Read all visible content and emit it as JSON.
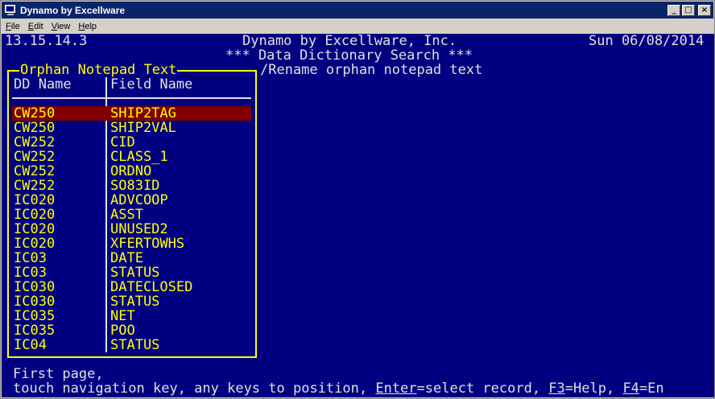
{
  "window": {
    "title": "Dynamo by Excellware",
    "minimize": "_",
    "maximize": "□",
    "close": "×"
  },
  "menu": [
    "File",
    "Edit",
    "View",
    "Help"
  ],
  "console": {
    "version": "13.15.14.3",
    "company": "Dynamo by Excellware, Inc.",
    "date": "Sun 06/08/2014",
    "subtitle": "*** Data Dictionary Search ***",
    "panel_title": "Orphan Notepad Text",
    "message": "/Rename orphan notepad text",
    "columns": [
      "DD Name",
      "Field Name"
    ],
    "rows": [
      {
        "dd": "CW250",
        "field": "SHIP2TAG",
        "selected": true
      },
      {
        "dd": "CW250",
        "field": "SHIP2VAL"
      },
      {
        "dd": "CW252",
        "field": "CID"
      },
      {
        "dd": "CW252",
        "field": "CLASS_1"
      },
      {
        "dd": "CW252",
        "field": "ORDNO"
      },
      {
        "dd": "CW252",
        "field": "SO83ID"
      },
      {
        "dd": "IC020",
        "field": "ADVCOOP"
      },
      {
        "dd": "IC020",
        "field": "ASST"
      },
      {
        "dd": "IC020",
        "field": "UNUSED2"
      },
      {
        "dd": "IC020",
        "field": "XFERTOWHS"
      },
      {
        "dd": "IC03",
        "field": "DATE"
      },
      {
        "dd": "IC03",
        "field": "STATUS"
      },
      {
        "dd": "IC030",
        "field": "DATECLOSED"
      },
      {
        "dd": "IC030",
        "field": "STATUS"
      },
      {
        "dd": "IC035",
        "field": "NET"
      },
      {
        "dd": "IC035",
        "field": "POO"
      },
      {
        "dd": "IC04",
        "field": "STATUS"
      }
    ],
    "status_line1": "First page,",
    "status_line2_a": "touch navigation key, any keys to position, ",
    "status_line2_b": "Enter",
    "status_line2_c": "=select record, ",
    "status_line2_d": "F3",
    "status_line2_e": "=Help, ",
    "status_line2_f": "F4",
    "status_line2_g": "=En"
  }
}
